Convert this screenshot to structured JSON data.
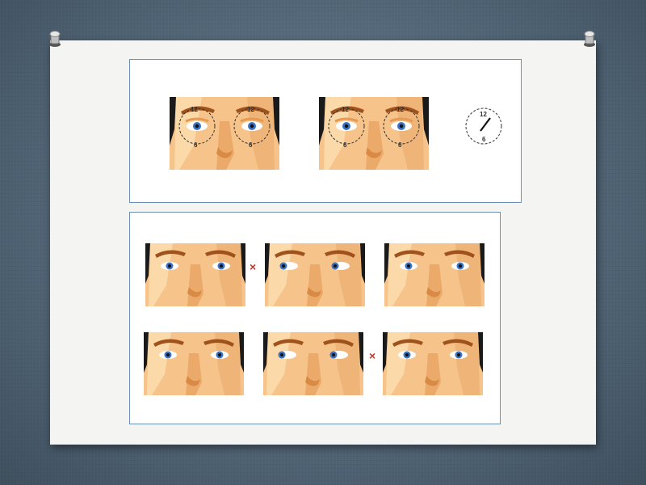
{
  "diagram": {
    "top_panel": {
      "faces": [
        {
          "labels": {
            "top_left": "12",
            "top_right": "12",
            "bottom_left": "6",
            "bottom_right": "6"
          }
        },
        {
          "labels": {
            "top_left": "12",
            "top_right": "12",
            "bottom_left": "6",
            "bottom_right": "6"
          }
        }
      ],
      "clock": {
        "top": "12",
        "bottom": "6"
      }
    },
    "bottom_panel": {
      "rows": [
        {
          "marker": "×"
        },
        {
          "marker": "×"
        }
      ]
    }
  },
  "colors": {
    "skin": "#f6c48a",
    "skin_light": "#fbd9a8",
    "skin_shadow": "#e59a55",
    "hair": "#1a1a1a",
    "iris": "#3a72c4",
    "marker_red": "#c0392b",
    "panel_border": "#6c8fb5"
  }
}
